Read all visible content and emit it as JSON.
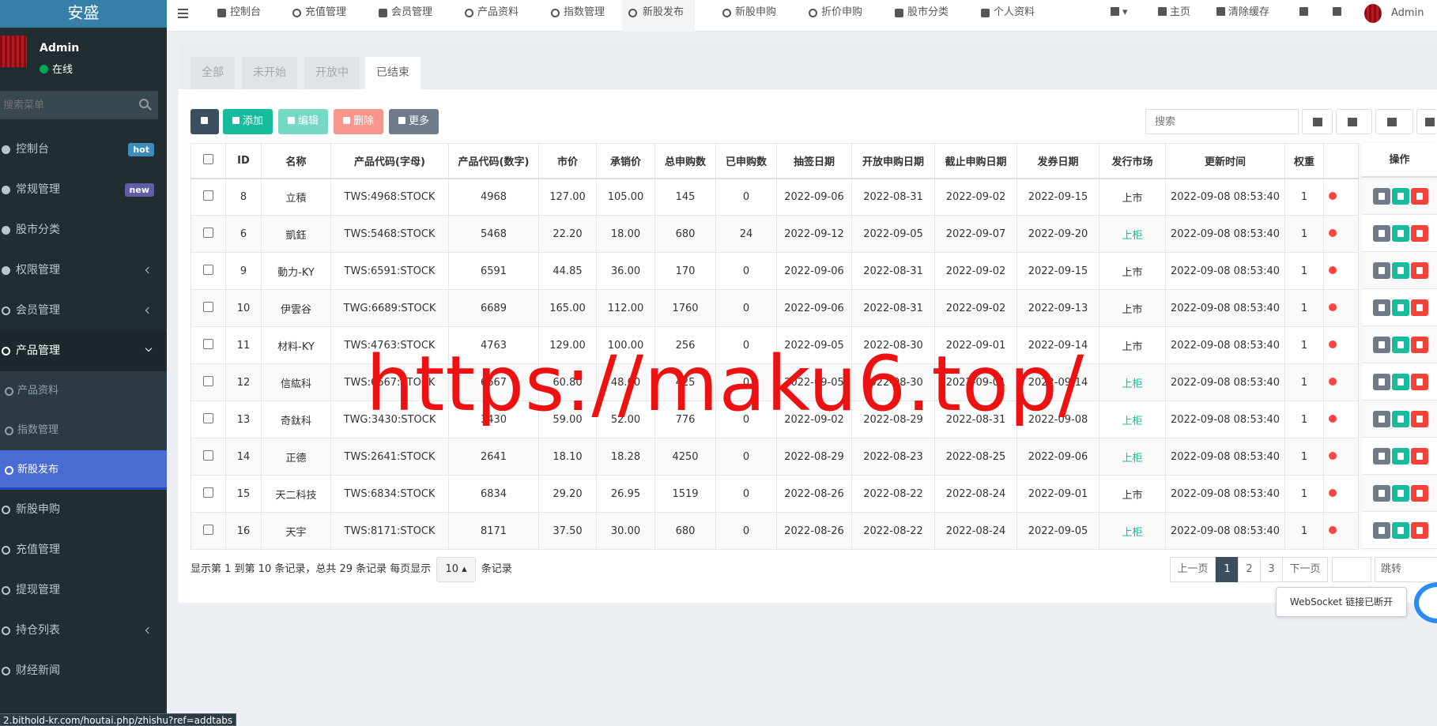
{
  "sidebar": {
    "logo": "安盛",
    "user_name": "Admin",
    "user_status": "在线",
    "search_placeholder": "搜索菜单",
    "items": [
      {
        "label": "控制台",
        "badge": "hot"
      },
      {
        "label": "常规管理",
        "badge": "new"
      },
      {
        "label": "股市分类"
      },
      {
        "label": "权限管理"
      },
      {
        "label": "会员管理"
      },
      {
        "label": "产品管理"
      },
      {
        "label": "产品资料"
      },
      {
        "label": "指数管理"
      },
      {
        "label": "新股发布"
      },
      {
        "label": "新股申购"
      },
      {
        "label": "充值管理"
      },
      {
        "label": "提现管理"
      },
      {
        "label": "持仓列表"
      },
      {
        "label": "财经新闻"
      }
    ]
  },
  "topbar": {
    "tabs": [
      "控制台",
      "充值管理",
      "会员管理",
      "产品资料",
      "指数管理",
      "新股发布",
      "新股申购",
      "折价申购",
      "股市分类",
      "个人资料"
    ],
    "home": "主页",
    "clear_cache": "清除缓存",
    "user": "Admin"
  },
  "panel": {
    "tabs": [
      "全部",
      "未开始",
      "开放中",
      "已结束"
    ],
    "buttons": {
      "add": "添加",
      "edit": "编辑",
      "delete": "删除",
      "more": "更多"
    },
    "search_placeholder": "搜索"
  },
  "table": {
    "columns": [
      "ID",
      "名称",
      "产品代码(字母)",
      "产品代码(数字)",
      "市价",
      "承销价",
      "总申购数",
      "已申购数",
      "抽签日期",
      "开放申购日期",
      "截止申购日期",
      "发券日期",
      "发行市场",
      "更新时间",
      "权重"
    ],
    "ops_header": "操作",
    "rows": [
      [
        "8",
        "立積",
        "TWS:4968:STOCK",
        "4968",
        "127.00",
        "105.00",
        "145",
        "0",
        "2022-09-06",
        "2022-08-31",
        "2022-09-02",
        "2022-09-15",
        "上市",
        "2022-09-08 08:53:40",
        "1"
      ],
      [
        "6",
        "凱鈺",
        "TWS:5468:STOCK",
        "5468",
        "22.20",
        "18.00",
        "680",
        "24",
        "2022-09-12",
        "2022-09-05",
        "2022-09-07",
        "2022-09-20",
        "上柜",
        "2022-09-08 08:53:40",
        "1"
      ],
      [
        "9",
        "動力-KY",
        "TWS:6591:STOCK",
        "6591",
        "44.85",
        "36.00",
        "170",
        "0",
        "2022-09-06",
        "2022-08-31",
        "2022-09-02",
        "2022-09-15",
        "上市",
        "2022-09-08 08:53:40",
        "1"
      ],
      [
        "10",
        "伊雲谷",
        "TWG:6689:STOCK",
        "6689",
        "165.00",
        "112.00",
        "1760",
        "0",
        "2022-09-06",
        "2022-08-31",
        "2022-09-02",
        "2022-09-13",
        "上市",
        "2022-09-08 08:53:40",
        "1"
      ],
      [
        "11",
        "材料-KY",
        "TWS:4763:STOCK",
        "4763",
        "129.00",
        "100.00",
        "256",
        "0",
        "2022-09-05",
        "2022-08-30",
        "2022-09-01",
        "2022-09-14",
        "上市",
        "2022-09-08 08:53:40",
        "1"
      ],
      [
        "12",
        "信紘科",
        "TWS:6667:STOCK",
        "6667",
        "60.80",
        "48.00",
        "425",
        "0",
        "2022-09-05",
        "2022-08-30",
        "2022-09-01",
        "2022-09-14",
        "上柜",
        "2022-09-08 08:53:40",
        "1"
      ],
      [
        "13",
        "奇鈦科",
        "TWG:3430:STOCK",
        "3430",
        "59.00",
        "52.00",
        "776",
        "0",
        "2022-09-02",
        "2022-08-29",
        "2022-08-31",
        "2022-09-08",
        "上柜",
        "2022-09-08 08:53:40",
        "1"
      ],
      [
        "14",
        "正德",
        "TWS:2641:STOCK",
        "2641",
        "18.10",
        "18.28",
        "4250",
        "0",
        "2022-08-29",
        "2022-08-23",
        "2022-08-25",
        "2022-09-06",
        "上柜",
        "2022-09-08 08:53:40",
        "1"
      ],
      [
        "15",
        "天二科技",
        "TWS:6834:STOCK",
        "6834",
        "29.20",
        "26.95",
        "1519",
        "0",
        "2022-08-26",
        "2022-08-22",
        "2022-08-24",
        "2022-09-01",
        "上市",
        "2022-09-08 08:53:40",
        "1"
      ],
      [
        "16",
        "天宇",
        "TWS:8171:STOCK",
        "8171",
        "37.50",
        "30.00",
        "680",
        "0",
        "2022-08-26",
        "2022-08-22",
        "2022-08-24",
        "2022-09-05",
        "上柜",
        "2022-09-08 08:53:40",
        "1"
      ]
    ]
  },
  "pagination": {
    "info_prefix": "显示第 1 到第 10 条记录，总共 29 条记录 每页显示",
    "page_size": "10",
    "info_suffix": "条记录",
    "prev": "上一页",
    "pages": [
      "1",
      "2",
      "3"
    ],
    "next": "下一页",
    "jump": "跳转"
  },
  "toast": "WebSocket 链接已断开",
  "watermark": "https://maku6.top/",
  "statusbar_url": "2.bithold-kr.com/houtai.php/zhishu?ref=addtabs",
  "colors": {
    "sidebar_bg": "#222d32",
    "active_menu": "#4b6bd4",
    "add_btn": "#18bc9c",
    "edit_btn": "#75d8c4",
    "delete_btn": "#f8968e",
    "more_btn": "#6f7b88",
    "refresh_btn": "#3c4f5f",
    "market_otc": "#18bc9c",
    "watermark": "#ee1111"
  }
}
